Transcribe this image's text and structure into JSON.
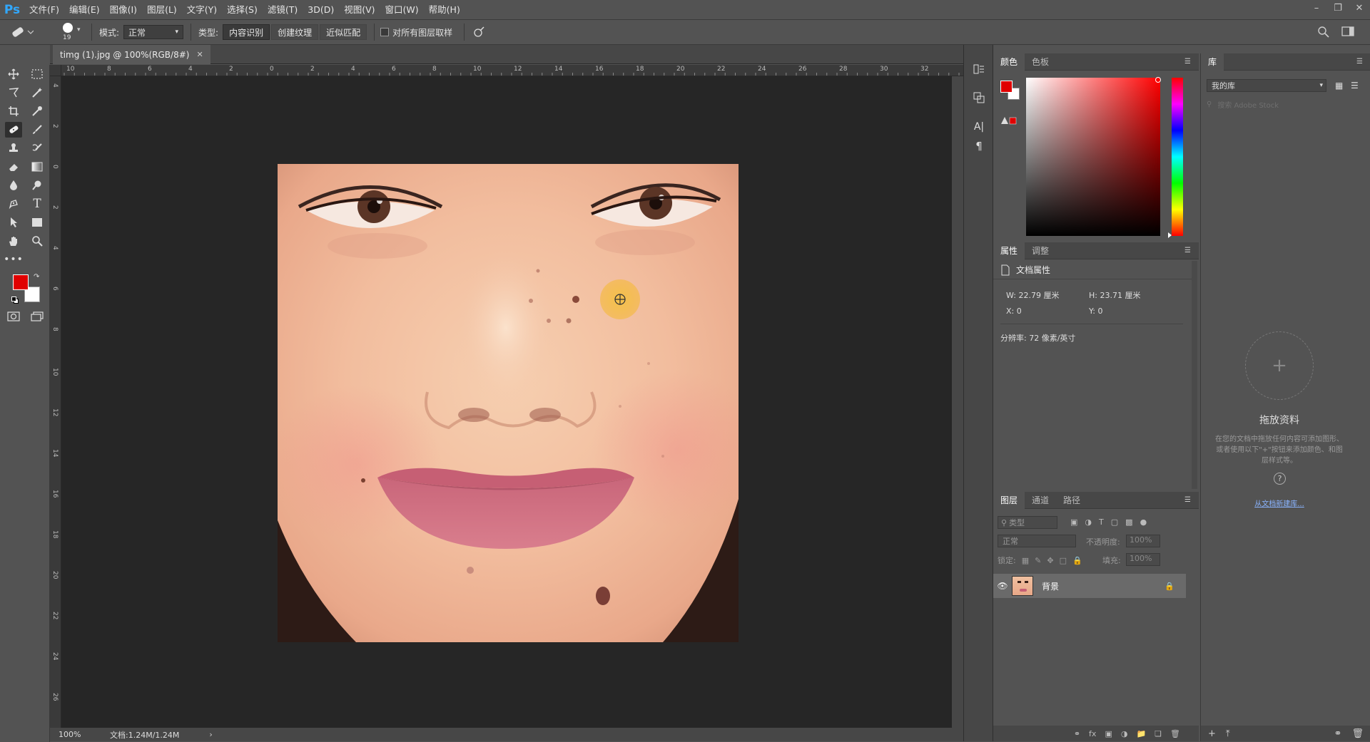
{
  "app": {
    "logo": "Ps",
    "logo_color": "#31a8ff"
  },
  "menu": [
    "文件(F)",
    "编辑(E)",
    "图像(I)",
    "图层(L)",
    "文字(Y)",
    "选择(S)",
    "滤镜(T)",
    "3D(D)",
    "视图(V)",
    "窗口(W)",
    "帮助(H)"
  ],
  "options": {
    "brush_size": "19",
    "mode_label": "模式:",
    "mode_value": "正常",
    "type_label": "类型:",
    "type_buttons": [
      "内容识别",
      "创建纹理",
      "近似匹配"
    ],
    "sample_all_label": "对所有图层取样"
  },
  "document": {
    "tab_title": "timg (1).jpg @ 100%(RGB/8#)",
    "zoom": "100%",
    "doc_size": "文档:1.24M/1.24M",
    "ruler_top": [
      "10",
      "8",
      "6",
      "4",
      "2",
      "0",
      "2",
      "4",
      "6",
      "8",
      "10",
      "12",
      "14",
      "16",
      "18",
      "20",
      "22",
      "24",
      "26",
      "28",
      "30",
      "32"
    ],
    "ruler_left": [
      "4",
      "2",
      "0",
      "2",
      "4",
      "6",
      "8",
      "10",
      "12",
      "14",
      "16",
      "18",
      "20",
      "22",
      "24",
      "26"
    ]
  },
  "color_panel": {
    "tabs": [
      "颜色",
      "色板"
    ],
    "foreground": "#e00000",
    "background": "#ffffff",
    "hue": "#ff0000"
  },
  "properties_panel": {
    "tabs": [
      "属性",
      "调整"
    ],
    "section_title": "文档属性",
    "w_label": "W:",
    "w_value": "22.79 厘米",
    "h_label": "H:",
    "h_value": "23.71 厘米",
    "x_label": "X:",
    "x_value": "0",
    "y_label": "Y:",
    "y_value": "0",
    "resolution": "分辨率: 72 像素/英寸"
  },
  "layers_panel": {
    "tabs": [
      "图层",
      "通道",
      "路径"
    ],
    "filter_placeholder": "类型",
    "blend_mode": "正常",
    "opacity_label": "不透明度:",
    "opacity_value": "100%",
    "lock_label": "锁定:",
    "fill_label": "填充:",
    "fill_value": "100%",
    "layers": [
      {
        "name": "背景",
        "visible": true,
        "locked": true
      }
    ]
  },
  "library_panel": {
    "tab": "库",
    "library_select": "我的库",
    "search_placeholder": "搜索 Adobe Stock",
    "drop_title": "拖放资料",
    "drop_desc": "在您的文档中拖放任何内容可添加图形、或者使用以下\"+\"按钮来添加颜色、和图层样式等。",
    "create_link": "从文档新建库..."
  }
}
